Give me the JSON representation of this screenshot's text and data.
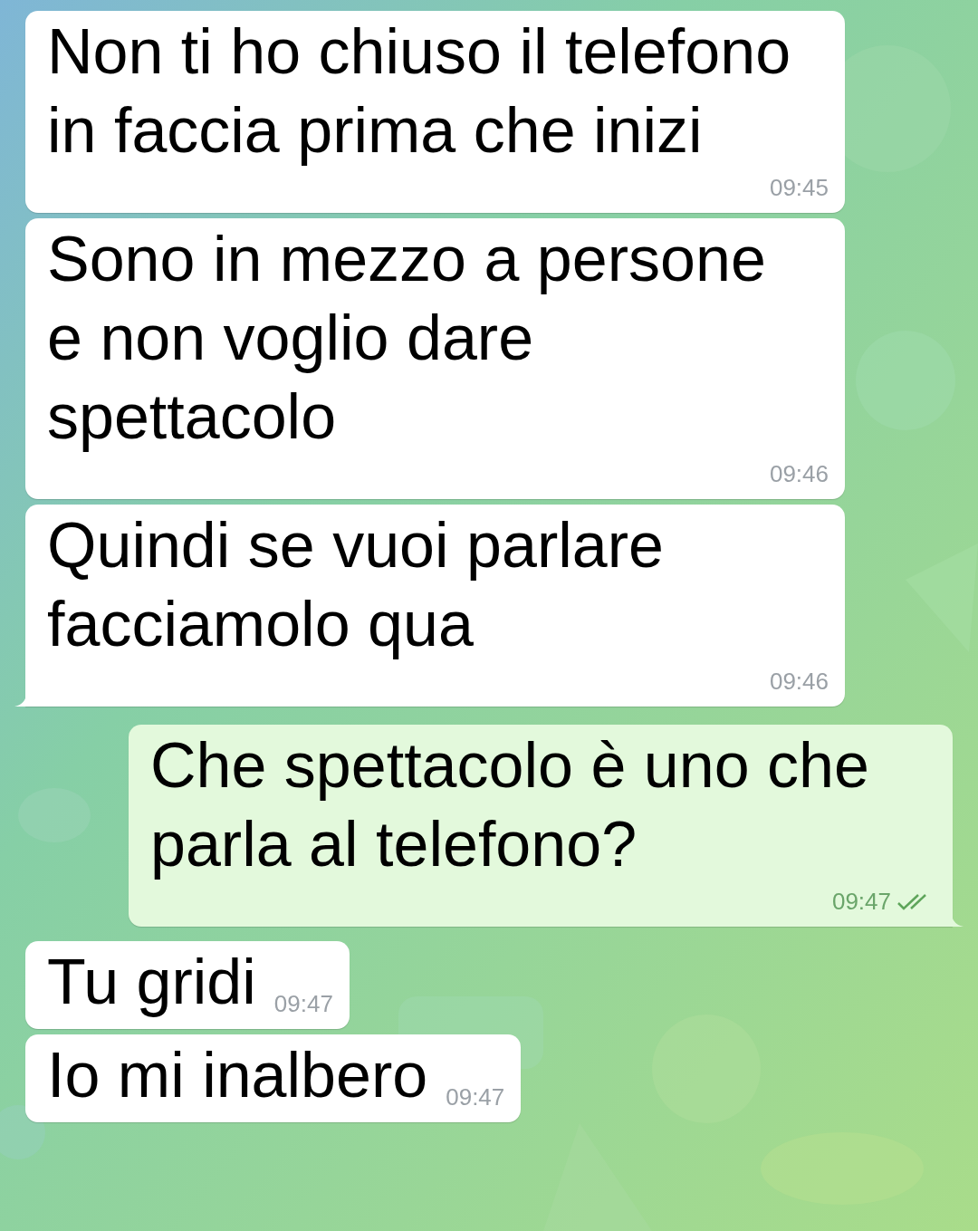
{
  "messages": [
    {
      "kind": "incoming",
      "text": "Non ti ho chiuso il telefono in faccia prima che inizi",
      "time": "09:45"
    },
    {
      "kind": "incoming",
      "text": "Sono in mezzo a persone e non voglio dare spettacolo",
      "time": "09:46"
    },
    {
      "kind": "incoming",
      "text": "Quindi se vuoi parlare facciamolo qua",
      "time": "09:46"
    },
    {
      "kind": "outgoing",
      "text": "Che spettacolo è uno che parla al telefono?",
      "time": "09:47",
      "read": true
    },
    {
      "kind": "incoming",
      "text": "Tu gridi",
      "time": "09:47"
    },
    {
      "kind": "incoming",
      "text": "Io mi inalbero",
      "time": "09:47"
    }
  ]
}
